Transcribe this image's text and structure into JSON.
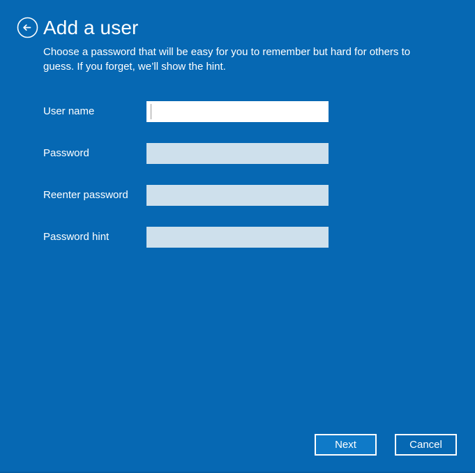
{
  "window": {
    "background_color": "#0668b3",
    "accent_color": "#0f7ac8",
    "field_color": "#cee0ec",
    "focused_field_color": "#ffffff"
  },
  "header": {
    "back_button_label": "Back",
    "back_icon": "circled-left-arrow-icon",
    "title": "Add a user",
    "subtitle": "Choose a password that will be easy for you to remember but hard for others to guess. If you forget, we’ll show the hint."
  },
  "form": {
    "fields": [
      {
        "label": "User name",
        "value": "",
        "placeholder": "",
        "type": "text",
        "focused": true,
        "name": "user-name"
      },
      {
        "label": "Password",
        "value": "",
        "placeholder": "",
        "type": "password",
        "focused": false,
        "name": "password"
      },
      {
        "label": "Reenter password",
        "value": "",
        "placeholder": "",
        "type": "password",
        "focused": false,
        "name": "reenter-password"
      },
      {
        "label": "Password hint",
        "value": "",
        "placeholder": "",
        "type": "text",
        "focused": false,
        "name": "password-hint"
      }
    ]
  },
  "footer": {
    "next_label": "Next",
    "cancel_label": "Cancel"
  }
}
